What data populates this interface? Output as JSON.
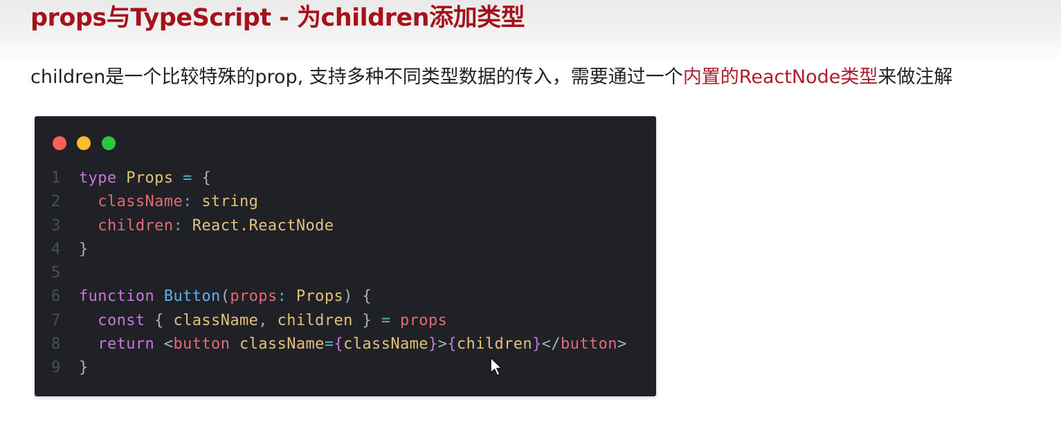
{
  "slide": {
    "title": "props与TypeScript - 为children添加类型"
  },
  "description": {
    "before": "children是一个比较特殊的prop, 支持多种不同类型数据的传入，需要通过一个",
    "highlight": "内置的ReactNode类型",
    "after": "来做注解"
  },
  "code_window": {
    "window_controls": [
      "close",
      "minimize",
      "maximize"
    ],
    "lines": [
      {
        "number": "1",
        "tokens": [
          {
            "text": "type",
            "kind": "kw"
          },
          {
            "text": " ",
            "kind": "pu"
          },
          {
            "text": "Props",
            "kind": "ty"
          },
          {
            "text": " ",
            "kind": "pu"
          },
          {
            "text": "=",
            "kind": "op"
          },
          {
            "text": " {",
            "kind": "pu"
          }
        ]
      },
      {
        "number": "2",
        "tokens": [
          {
            "text": "  ",
            "kind": "pu"
          },
          {
            "text": "className",
            "kind": "pr"
          },
          {
            "text": ": ",
            "kind": "op"
          },
          {
            "text": "string",
            "kind": "ty"
          }
        ]
      },
      {
        "number": "3",
        "tokens": [
          {
            "text": "  ",
            "kind": "pu"
          },
          {
            "text": "children",
            "kind": "pr"
          },
          {
            "text": ": ",
            "kind": "op"
          },
          {
            "text": "React.ReactNode",
            "kind": "ty"
          }
        ]
      },
      {
        "number": "4",
        "tokens": [
          {
            "text": "}",
            "kind": "pu"
          }
        ]
      },
      {
        "number": "5",
        "tokens": []
      },
      {
        "number": "6",
        "tokens": [
          {
            "text": "function",
            "kind": "kw"
          },
          {
            "text": " ",
            "kind": "pu"
          },
          {
            "text": "Button",
            "kind": "fn"
          },
          {
            "text": "(",
            "kind": "pu"
          },
          {
            "text": "props",
            "kind": "pr"
          },
          {
            "text": ": ",
            "kind": "op"
          },
          {
            "text": "Props",
            "kind": "ty"
          },
          {
            "text": ") {",
            "kind": "pu"
          }
        ]
      },
      {
        "number": "7",
        "tokens": [
          {
            "text": "  ",
            "kind": "pu"
          },
          {
            "text": "const",
            "kind": "kw"
          },
          {
            "text": " { ",
            "kind": "pu"
          },
          {
            "text": "className",
            "kind": "ty"
          },
          {
            "text": ", ",
            "kind": "pu"
          },
          {
            "text": "children",
            "kind": "ty"
          },
          {
            "text": " } ",
            "kind": "pu"
          },
          {
            "text": "=",
            "kind": "op"
          },
          {
            "text": " ",
            "kind": "pu"
          },
          {
            "text": "props",
            "kind": "pr"
          }
        ]
      },
      {
        "number": "8",
        "tokens": [
          {
            "text": "  ",
            "kind": "pu"
          },
          {
            "text": "return",
            "kind": "kw"
          },
          {
            "text": " <",
            "kind": "pu"
          },
          {
            "text": "button",
            "kind": "tg"
          },
          {
            "text": " ",
            "kind": "pu"
          },
          {
            "text": "className",
            "kind": "ty"
          },
          {
            "text": "=",
            "kind": "op"
          },
          {
            "text": "{",
            "kind": "kw"
          },
          {
            "text": "className",
            "kind": "ty"
          },
          {
            "text": "}",
            "kind": "kw"
          },
          {
            "text": ">",
            "kind": "pu"
          },
          {
            "text": "{",
            "kind": "kw"
          },
          {
            "text": "children",
            "kind": "ty"
          },
          {
            "text": "}",
            "kind": "kw"
          },
          {
            "text": "</",
            "kind": "pu"
          },
          {
            "text": "button",
            "kind": "tg"
          },
          {
            "text": ">",
            "kind": "pu"
          }
        ]
      },
      {
        "number": "9",
        "tokens": [
          {
            "text": "}",
            "kind": "pu"
          }
        ]
      }
    ]
  },
  "colors": {
    "title": "#a5121c",
    "highlight": "#b01c2c",
    "code_background": "#1f2127",
    "keyword": "#c678dd",
    "type": "#e5c07b",
    "property": "#e06c75",
    "function": "#61afef",
    "operator": "#56b6c2"
  },
  "icons": {
    "cursor": "mouse-pointer-icon"
  }
}
